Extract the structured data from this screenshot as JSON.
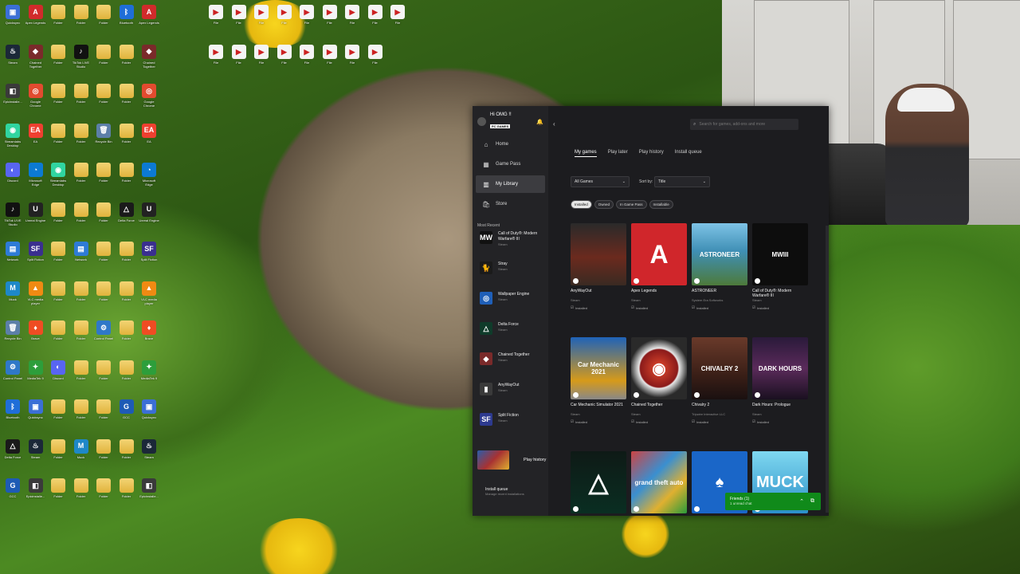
{
  "desktop": {
    "icons": [
      {
        "label": "Quicksync",
        "glyph": "▣",
        "color": "#3b6fd6"
      },
      {
        "label": "Steam",
        "glyph": "♨",
        "color": "#1b2838"
      },
      {
        "label": "Epicinstalle...",
        "glyph": "◧",
        "color": "#3a3a3a"
      },
      {
        "label": "Streamlabs Desktop",
        "glyph": "◉",
        "color": "#30d5a0"
      },
      {
        "label": "Discord",
        "glyph": "◐",
        "color": "#5865f2"
      },
      {
        "label": "TikTok LIVE Studio",
        "glyph": "♪",
        "color": "#111"
      },
      {
        "label": "Network",
        "glyph": "▤",
        "color": "#2e7bd6"
      },
      {
        "label": "Muck",
        "glyph": "M",
        "color": "#1e88c8"
      },
      {
        "label": "Recycle Bin",
        "glyph": "🗑",
        "color": "#5c7fa8"
      },
      {
        "label": "Control Panel",
        "glyph": "⚙",
        "color": "#2f78c8"
      },
      {
        "label": "Bluetooth",
        "glyph": "ᛒ",
        "color": "#1f6ed8"
      },
      {
        "label": "Delta Force",
        "glyph": "△",
        "color": "#1a1a1a"
      },
      {
        "label": "GCC",
        "glyph": "G",
        "color": "#1e5bb5"
      },
      {
        "label": "Apex Legends",
        "glyph": "A",
        "color": "#d12b2b"
      },
      {
        "label": "Chained Together",
        "glyph": "◆",
        "color": "#7a2a2a"
      },
      {
        "label": "Google Chrome",
        "glyph": "◎",
        "color": "#e24b2f"
      },
      {
        "label": "EA",
        "glyph": "EA",
        "color": "#ef4030"
      },
      {
        "label": "Microsoft Edge",
        "glyph": "◔",
        "color": "#0c7ad3"
      },
      {
        "label": "Unreal Engine",
        "glyph": "U",
        "color": "#222"
      },
      {
        "label": "Split Fiction",
        "glyph": "SF",
        "color": "#3a2f8f"
      },
      {
        "label": "VLC media player",
        "glyph": "▲",
        "color": "#f08a13"
      },
      {
        "label": "Brave",
        "glyph": "♦",
        "color": "#ef4c23"
      },
      {
        "label": "MediaTek 9",
        "glyph": "✦",
        "color": "#2d9e3b"
      }
    ],
    "folder_label": "Folder",
    "file_label": "File"
  },
  "xbox": {
    "profile": {
      "name": "Hi OMG !!",
      "badge": "PC GAMES"
    },
    "nav": [
      {
        "label": "Home",
        "icon": "⌂"
      },
      {
        "label": "Game Pass",
        "icon": "▦"
      },
      {
        "label": "My Library",
        "icon": "▥"
      },
      {
        "label": "Store",
        "icon": "🛍"
      }
    ],
    "most_recent_label": "Most Recent",
    "recent": [
      {
        "title": "Call of Duty®: Modern Warfare® III",
        "sub": "Steam",
        "glyph": "MW",
        "color": "#111"
      },
      {
        "title": "Stray",
        "sub": "Steam",
        "glyph": "🐈",
        "color": "#1b1b1b"
      },
      {
        "title": "Wallpaper Engine",
        "sub": "Steam",
        "glyph": "◎",
        "color": "#1f5fb8"
      },
      {
        "title": "Delta Force",
        "sub": "Steam",
        "glyph": "△",
        "color": "#0f3b2a"
      },
      {
        "title": "Chained Together",
        "sub": "Steam",
        "glyph": "◆",
        "color": "#7a2a2a"
      },
      {
        "title": "AnyWayOut",
        "sub": "Steam",
        "glyph": "▮",
        "color": "#3a3a3a"
      },
      {
        "title": "Split Fiction",
        "sub": "Steam",
        "glyph": "SF",
        "color": "#2d3a8f"
      }
    ],
    "play_history": "Play history",
    "install_queue": {
      "title": "Install queue",
      "sub": "Manage recent installations"
    },
    "search_placeholder": "Search for games, add-ons and more",
    "tabs": [
      "My games",
      "Play later",
      "Play history",
      "Install queue"
    ],
    "filter_select": "All Games",
    "sort_label": "Sort by:",
    "sort_value": "Title",
    "chips": [
      "Installed",
      "Owned",
      "In Game Pass",
      "Installable"
    ],
    "games": [
      {
        "title": "AnyWayOut",
        "pub": "Steam",
        "status": "Installed",
        "cover_text": "",
        "bg": "linear-gradient(180deg,#2a2a2a,#6b2a1e 55%,#3a2a22)"
      },
      {
        "title": "Apex Legends",
        "pub": "Steam",
        "status": "Installed",
        "cover_text": "A",
        "bg": "#d0262b"
      },
      {
        "title": "ASTRONEER",
        "pub": "System Era Softworks",
        "status": "Installed",
        "cover_text": "ASTRONEER",
        "bg": "linear-gradient(180deg,#7ec3e6,#3f8fb5 45%,#4d7a3a)"
      },
      {
        "title": "Call of Duty®: Modern Warfare® III",
        "pub": "Steam",
        "status": "Installed",
        "cover_text": "MWIII",
        "bg": "#0d0d0d"
      },
      {
        "title": "Car Mechanic Simulator 2021",
        "pub": "Steam",
        "status": "Installed",
        "cover_text": "Car Mechanic 2021",
        "bg": "linear-gradient(180deg,#1f62b8,#d69a1a 70%,#888)"
      },
      {
        "title": "Chained Together",
        "pub": "Steam",
        "status": "Installed",
        "cover_text": "◉",
        "bg": "radial-gradient(circle,#e34a2d 0%,#8a1a1a 45%,#e8e8e8 48%,#2a2a2a 70%)"
      },
      {
        "title": "Chivalry 2",
        "pub": "Tripwire Interactive LLC",
        "status": "Installed",
        "cover_text": "CHIVALRY 2",
        "bg": "linear-gradient(180deg,#6a3a2a,#3b1f17 60%,#1a1010)"
      },
      {
        "title": "Dark Hours: Prologue",
        "pub": "Steam",
        "status": "Installed",
        "cover_text": "DARK HOURS",
        "bg": "linear-gradient(180deg,#2a1a3a,#5a2a5a 50%,#1a1020)"
      },
      {
        "title": "Delta Force",
        "pub": "Steam",
        "status": "Installed",
        "cover_text": "△",
        "bg": "linear-gradient(180deg,#0e1a16,#0a2e22)"
      },
      {
        "title": "Grand Theft Auto V",
        "pub": "Steam",
        "status": "Installed",
        "cover_text": "grand theft auto",
        "bg": "linear-gradient(135deg,#c44,#3a8fd0 40%,#e0b030 70%,#2a9a3a)"
      },
      {
        "title": "Microsoft Solitaire Collection",
        "pub": "Microsoft",
        "status": "Installed",
        "cover_text": "♠",
        "bg": "#1a66c8"
      },
      {
        "title": "Muck",
        "pub": "Steam",
        "status": "Installed",
        "cover_text": "MUCK",
        "bg": "linear-gradient(180deg,#7fd8f0,#2b8fc8)"
      }
    ],
    "friends": {
      "title": "Friends (1)",
      "sub": "1 unread chat"
    }
  }
}
